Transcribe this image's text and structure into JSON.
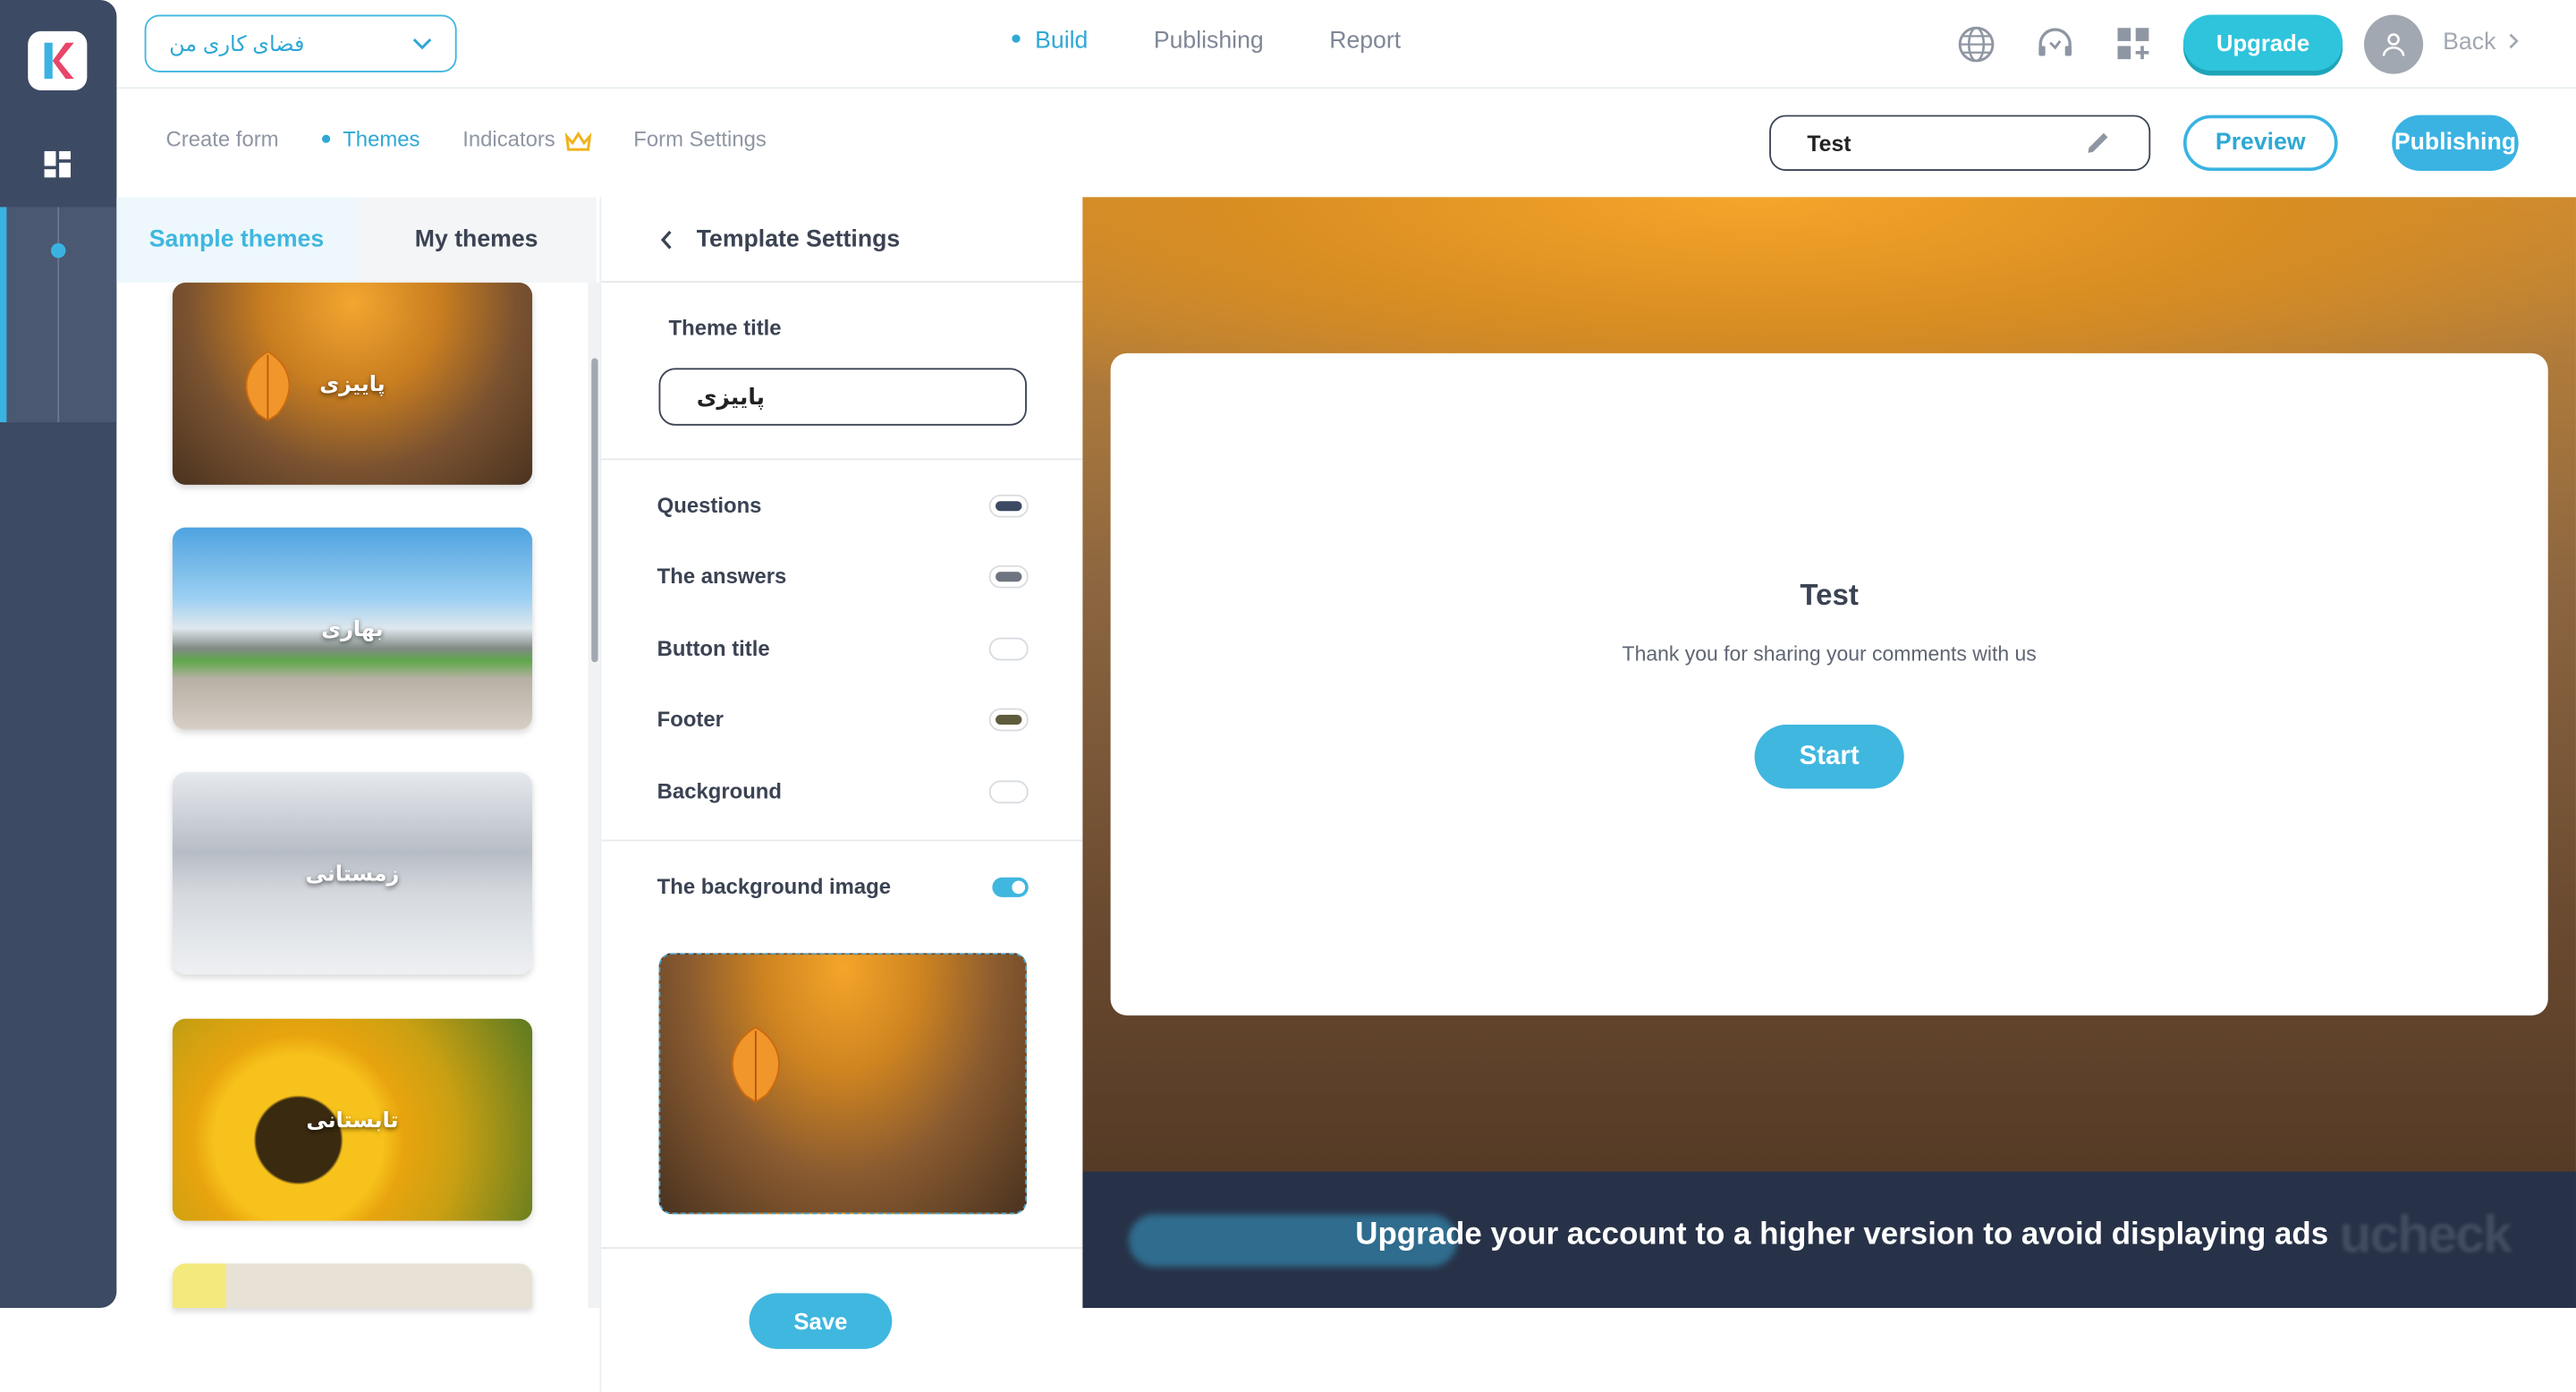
{
  "workspace": {
    "label": "فضای کاری من"
  },
  "nav": {
    "build": "Build",
    "publishing": "Publishing",
    "report": "Report"
  },
  "topbar": {
    "upgrade": "Upgrade",
    "back": "Back"
  },
  "subnav": {
    "create_form": "Create form",
    "themes": "Themes",
    "indicators": "Indicators",
    "form_settings": "Form Settings"
  },
  "form": {
    "title_value": "Test",
    "preview": "Preview",
    "publishing": "Publishing"
  },
  "themes_panel": {
    "tab_sample": "Sample themes",
    "tab_my": "My themes",
    "cards": [
      {
        "label": "پاییزی"
      },
      {
        "label": "بهاری"
      },
      {
        "label": "زمستانی"
      },
      {
        "label": "تابستانی"
      }
    ]
  },
  "settings": {
    "header": "Template Settings",
    "theme_title_label": "Theme title",
    "theme_title_value": "پاییزی",
    "rows": [
      {
        "label": "Questions",
        "color": "#3d4a63"
      },
      {
        "label": "The answers",
        "color": "#6e7580"
      },
      {
        "label": "Button title",
        "color": "#ffffff"
      },
      {
        "label": "Footer",
        "color": "#5f5c3e"
      },
      {
        "label": "Background",
        "color": "#ffffff"
      }
    ],
    "bg_image_label": "The background image",
    "save": "Save"
  },
  "preview": {
    "title": "Test",
    "message": "Thank you for sharing your comments with us",
    "start": "Start",
    "ad_text": "Upgrade your account to a higher version to avoid displaying ads",
    "ad_logo": "ucheck"
  },
  "colors": {
    "accent": "#3ab3e2",
    "rail": "#3d4a63",
    "upgrade": "#2ec4dc"
  }
}
